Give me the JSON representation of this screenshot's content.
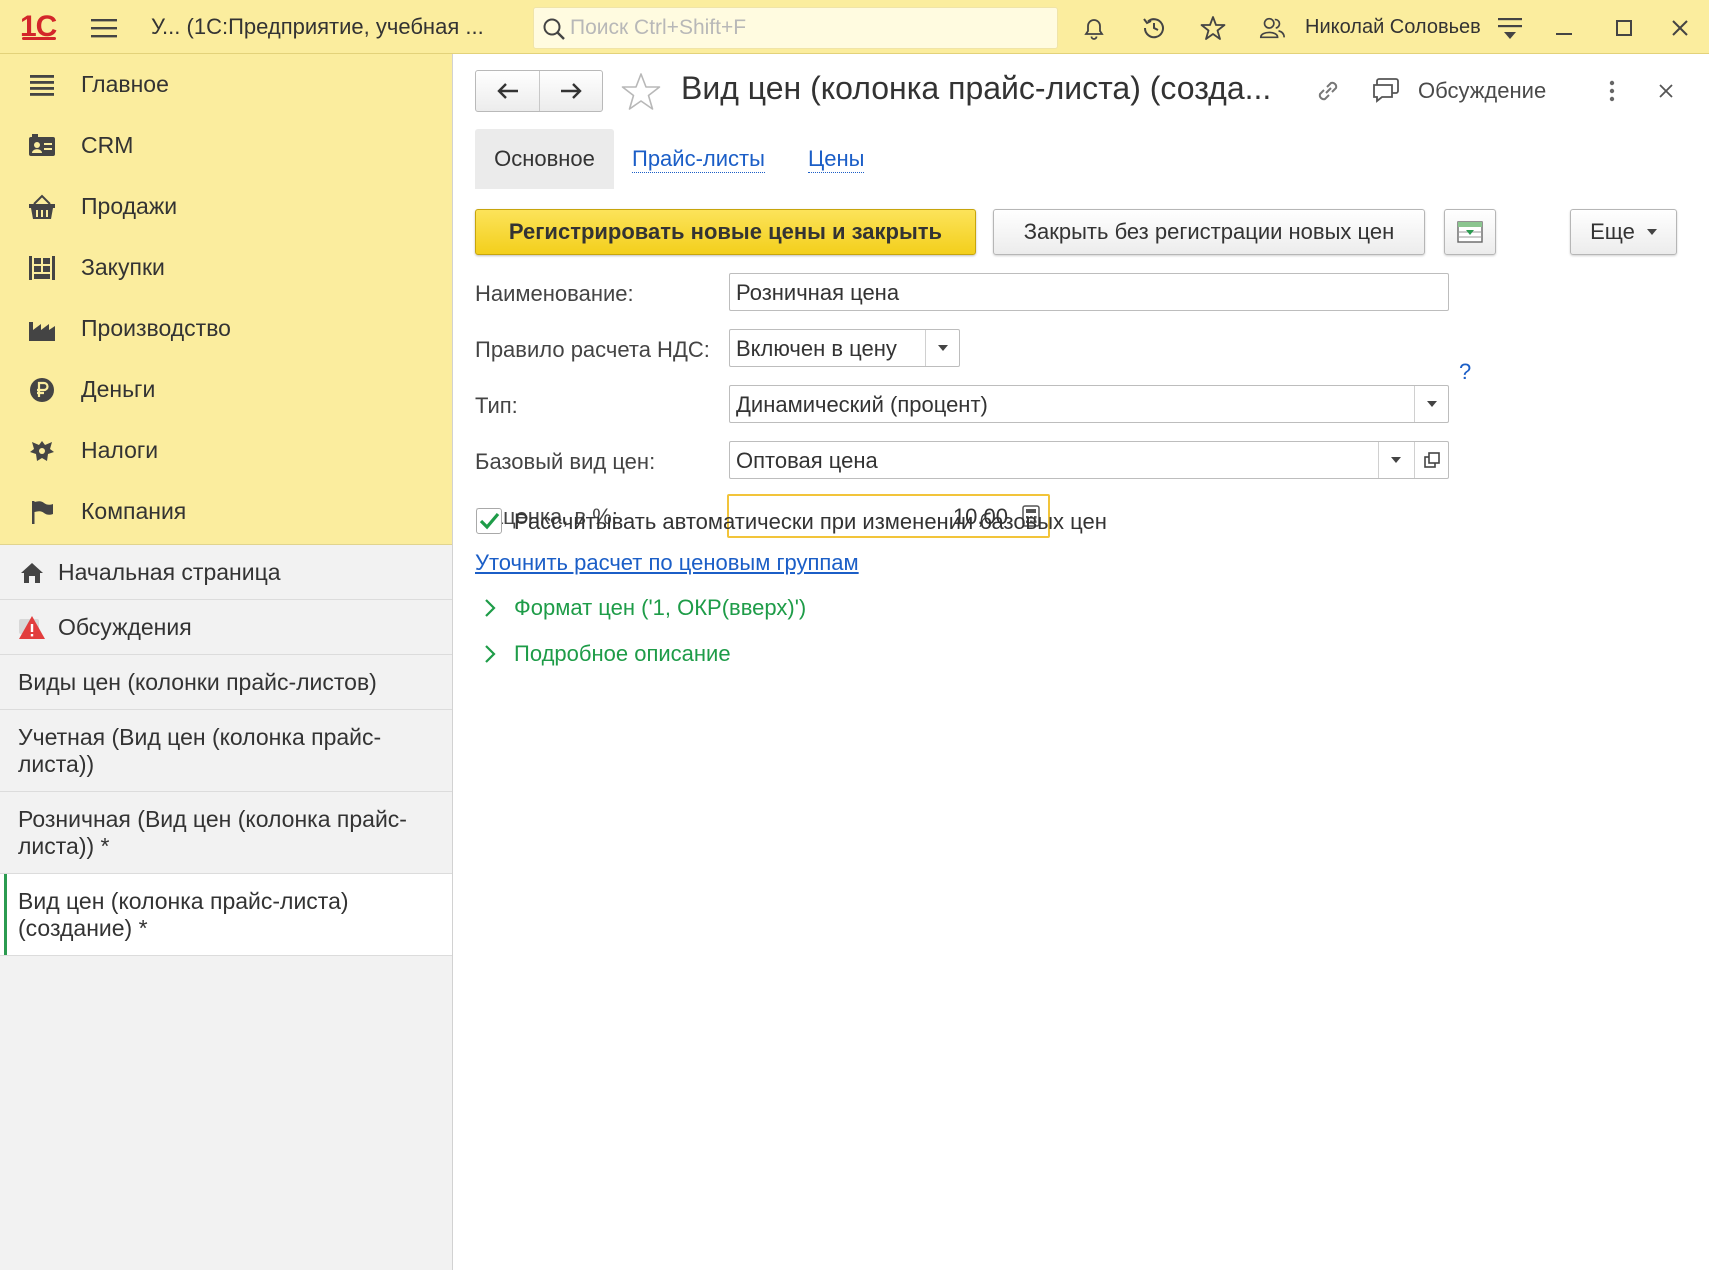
{
  "titlebar": {
    "logo": "1С",
    "app_title": "У...  (1С:Предприятие, учебная ...",
    "search_placeholder": "Поиск Ctrl+Shift+F",
    "user": "Николай Соловьев"
  },
  "sidebar": {
    "sections": [
      {
        "label": "Главное",
        "icon": "menu-lines-icon"
      },
      {
        "label": "CRM",
        "icon": "contact-card-icon"
      },
      {
        "label": "Продажи",
        "icon": "basket-icon"
      },
      {
        "label": "Закупки",
        "icon": "warehouse-icon"
      },
      {
        "label": "Производство",
        "icon": "factory-icon"
      },
      {
        "label": "Деньги",
        "icon": "ruble-icon"
      },
      {
        "label": "Налоги",
        "icon": "coat-of-arms-icon"
      },
      {
        "label": "Компания",
        "icon": "flag-icon"
      }
    ],
    "open": [
      {
        "label": "Начальная страница",
        "icon": "home-icon"
      },
      {
        "label": "Обсуждения",
        "icon": "discussions-alert-icon"
      },
      {
        "label": "Виды цен (колонки прайс-листов)"
      },
      {
        "label": "Учетная (Вид цен (колонка прайс-листа))"
      },
      {
        "label": "Розничная (Вид цен (колонка прайс-листа)) *"
      },
      {
        "label": "Вид цен (колонка прайс-листа) (создание) *"
      }
    ]
  },
  "form": {
    "title": "Вид цен (колонка прайс-листа) (созда...",
    "discussion": "Обсуждение",
    "tabs": [
      "Основное",
      "Прайс-листы",
      "Цены"
    ],
    "buttons": {
      "register": "Регистрировать новые цены и закрыть",
      "close": "Закрыть без регистрации новых цен",
      "more": "Еще"
    },
    "fields": {
      "name_label": "Наименование:",
      "name_value": "Розничная цена",
      "vat_label": "Правило расчета НДС:",
      "vat_value": "Включен в цену",
      "type_label": "Тип:",
      "type_value": "Динамический (процент)",
      "help": "?",
      "base_label": "Базовый вид цен:",
      "base_value": "Оптовая цена",
      "markup_label": "Наценка, в %:",
      "markup_value": "10,00"
    },
    "checkbox_label": "Рассчитывать автоматически при изменении базовых цен",
    "checkbox_checked": true,
    "link": "Уточнить расчет по ценовым группам",
    "groups": [
      "Формат цен ('1, ОКР(вверх)')",
      "Подробное описание"
    ]
  },
  "colors": {
    "titlebar": "#fbed9e",
    "accent_green": "#1e9c48",
    "link_blue": "#1b5ec7",
    "primary_button": "#f3cf1c"
  }
}
